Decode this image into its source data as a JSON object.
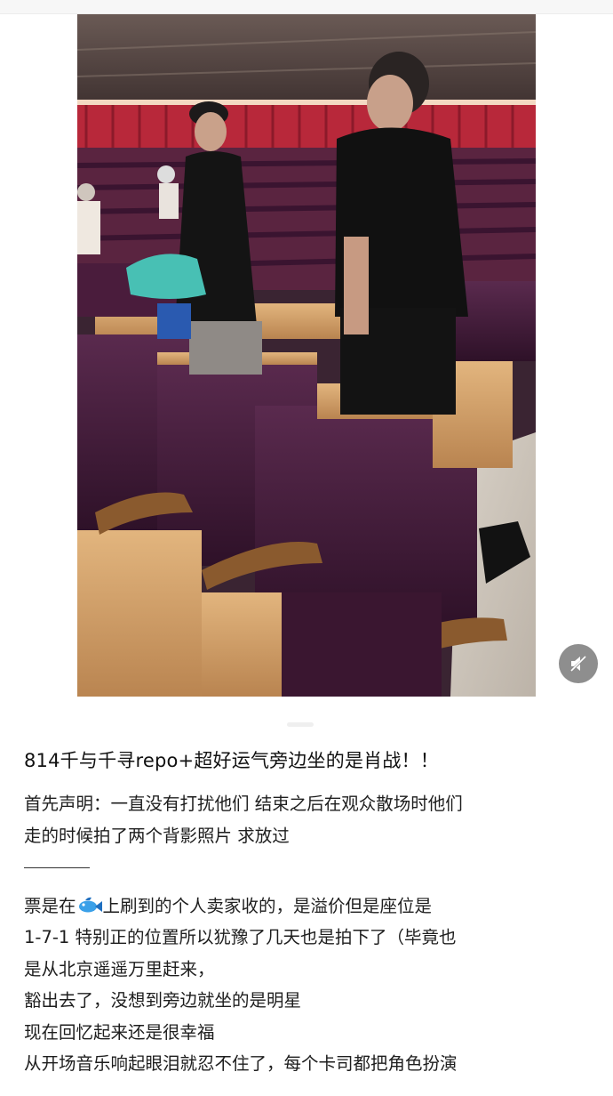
{
  "photo": {
    "description_icon": "theater-photo"
  },
  "controls": {
    "speaker_icon": "speaker-icon"
  },
  "post": {
    "title": "814千与千寻repo+超好运气旁边坐的是肖战！！",
    "intro_line1": "首先声明：一直没有打扰他们 结束之后在观众散场时他们",
    "intro_line2": "走的时候拍了两个背影照片 求放过",
    "ticket_prefix": "票是在",
    "ticket_suffix": "上刷到的个人卖家收的，是溢价但是座位是",
    "line_seat": "1-7-1 特别正的位置所以犹豫了几天也是拍下了（毕竟也",
    "line_beijing": "是从北京遥遥万里赶来，",
    "line_out": "豁出去了，没想到旁边就坐的是明星",
    "line_recall": "现在回忆起来还是很幸福",
    "line_music": "从开场音乐响起眼泪就忍不住了，每个卡司都把角色扮演"
  },
  "colors": {
    "seat_purple": "#4a2140",
    "seat_wood": "#d8a46a",
    "curtain_red": "#b8283a"
  }
}
